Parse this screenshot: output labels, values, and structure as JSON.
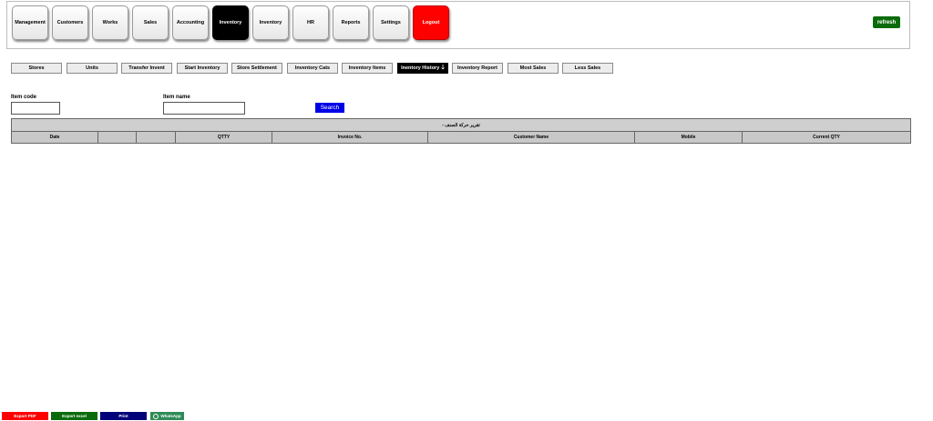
{
  "nav": {
    "items": [
      {
        "label": "Management"
      },
      {
        "label": "Customers"
      },
      {
        "label": "Works"
      },
      {
        "label": "Sales"
      },
      {
        "label": "Accounting"
      },
      {
        "label": "Inventory",
        "active": true
      },
      {
        "label": "Inventory"
      },
      {
        "label": "HR"
      },
      {
        "label": "Reports"
      },
      {
        "label": "Settings"
      },
      {
        "label": "Logout"
      }
    ],
    "refresh_label": "refresh"
  },
  "subnav": {
    "items": [
      {
        "label": "Stores"
      },
      {
        "label": "Units"
      },
      {
        "label": "Transfer Invent"
      },
      {
        "label": "Start Inventory"
      },
      {
        "label": "Store Settlement"
      },
      {
        "label": "Inventory Cats"
      },
      {
        "label": "Inventory Items"
      },
      {
        "label": "Inentory History",
        "active": true
      },
      {
        "label": "Inventory Report"
      },
      {
        "label": "Most Sales"
      },
      {
        "label": "Less Sales"
      }
    ],
    "active_arrow": "🡓"
  },
  "filters": {
    "item_code_label": "Item code",
    "item_code_value": "",
    "item_name_label": "Item name",
    "item_name_value": "",
    "search_label": "Search"
  },
  "report": {
    "title": "- تقرير حركة الصنف",
    "columns": [
      "Date",
      "",
      "",
      "QTTY",
      "Invoice No.",
      "Customer Name",
      "Mobile",
      "Current QTY"
    ]
  },
  "footer": {
    "export_pdf": "Export PDF",
    "export_excel": "Export excel",
    "print": "Print",
    "whatsapp": "WhatsApp"
  },
  "colors": {
    "active": "#000000",
    "logout": "#ff0000",
    "refresh": "#0b6b0b",
    "search": "#0000e6",
    "export_pdf": "#ff0000",
    "export_excel": "#0b6b0b",
    "print": "#00007a",
    "whatsapp": "#2e8b57"
  }
}
